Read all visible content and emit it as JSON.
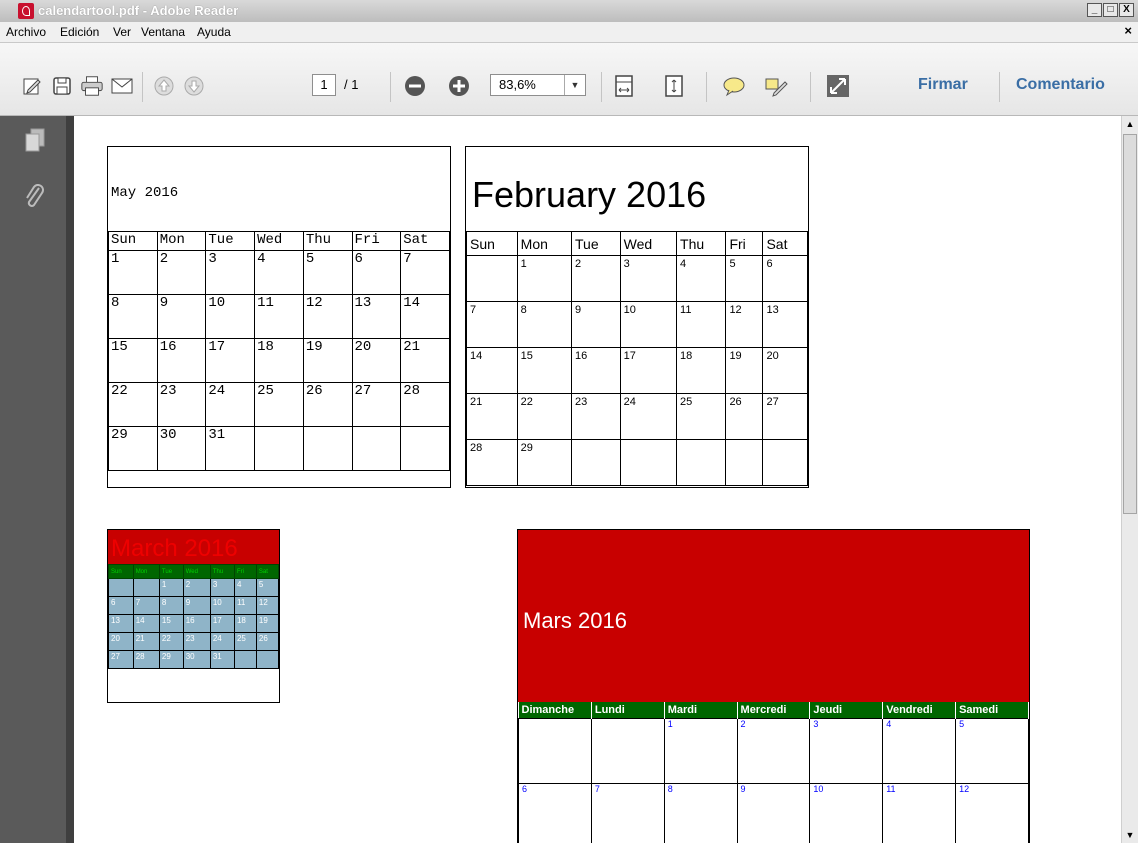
{
  "window": {
    "title": "calendartool.pdf - Adobe Reader",
    "min_glyph": "_",
    "max_glyph": "□",
    "close_glyph": "X"
  },
  "menu": {
    "items": [
      "Archivo",
      "Edición",
      "Ver",
      "Ventana",
      "Ayuda"
    ],
    "close_glyph": "×"
  },
  "toolbar": {
    "page_current": "1",
    "page_total": "/ 1",
    "zoom": "83,6%",
    "zoom_dropdown_glyph": "▼",
    "sign_label": "Firmar",
    "comment_label": "Comentario",
    "icons": [
      "edit-icon",
      "save-icon",
      "print-icon",
      "email-icon",
      "page-up-icon",
      "page-down-icon",
      "zoom-out-icon",
      "zoom-in-icon",
      "fit-width-icon",
      "fit-page-icon",
      "comment-icon",
      "highlight-icon",
      "fullscreen-icon"
    ]
  },
  "leftnav": {
    "icons": [
      "pages-icon",
      "attachment-icon"
    ]
  },
  "scrollbar": {
    "up_glyph": "▲",
    "down_glyph": "▼"
  },
  "calendars": {
    "may": {
      "title": "May 2016",
      "days": [
        "Sun",
        "Mon",
        "Tue",
        "Wed",
        "Thu",
        "Fri",
        "Sat"
      ],
      "weeks": [
        [
          "1",
          "2",
          "3",
          "4",
          "5",
          "6",
          "7"
        ],
        [
          "8",
          "9",
          "10",
          "11",
          "12",
          "13",
          "14"
        ],
        [
          "15",
          "16",
          "17",
          "18",
          "19",
          "20",
          "21"
        ],
        [
          "22",
          "23",
          "24",
          "25",
          "26",
          "27",
          "28"
        ],
        [
          "29",
          "30",
          "31",
          "",
          "",
          "",
          ""
        ]
      ]
    },
    "february": {
      "title": "February 2016",
      "days": [
        "Sun",
        "Mon",
        "Tue",
        "Wed",
        "Thu",
        "Fri",
        "Sat"
      ],
      "weeks": [
        [
          "",
          "1",
          "2",
          "3",
          "4",
          "5",
          "6"
        ],
        [
          "7",
          "8",
          "9",
          "10",
          "11",
          "12",
          "13"
        ],
        [
          "14",
          "15",
          "16",
          "17",
          "18",
          "19",
          "20"
        ],
        [
          "21",
          "22",
          "23",
          "24",
          "25",
          "26",
          "27"
        ],
        [
          "28",
          "29",
          "",
          "",
          "",
          "",
          ""
        ]
      ]
    },
    "march": {
      "title": "March 2016",
      "days": [
        "Sun",
        "Mon",
        "Tue",
        "Wed",
        "Thu",
        "Fri",
        "Sat"
      ],
      "weeks": [
        [
          "",
          "",
          "1",
          "2",
          "3",
          "4",
          "5"
        ],
        [
          "6",
          "7",
          "8",
          "9",
          "10",
          "11",
          "12"
        ],
        [
          "13",
          "14",
          "15",
          "16",
          "17",
          "18",
          "19"
        ],
        [
          "20",
          "21",
          "22",
          "23",
          "24",
          "25",
          "26"
        ],
        [
          "27",
          "28",
          "29",
          "30",
          "31",
          "",
          ""
        ]
      ]
    },
    "mars": {
      "title": "Mars 2016",
      "days": [
        "Dimanche",
        "Lundi",
        "Mardi",
        "Mercredi",
        "Jeudi",
        "Vendredi",
        "Samedi"
      ],
      "weeks": [
        [
          "",
          "",
          "1",
          "2",
          "3",
          "4",
          "5"
        ],
        [
          "6",
          "7",
          "8",
          "9",
          "10",
          "11",
          "12"
        ]
      ]
    }
  }
}
